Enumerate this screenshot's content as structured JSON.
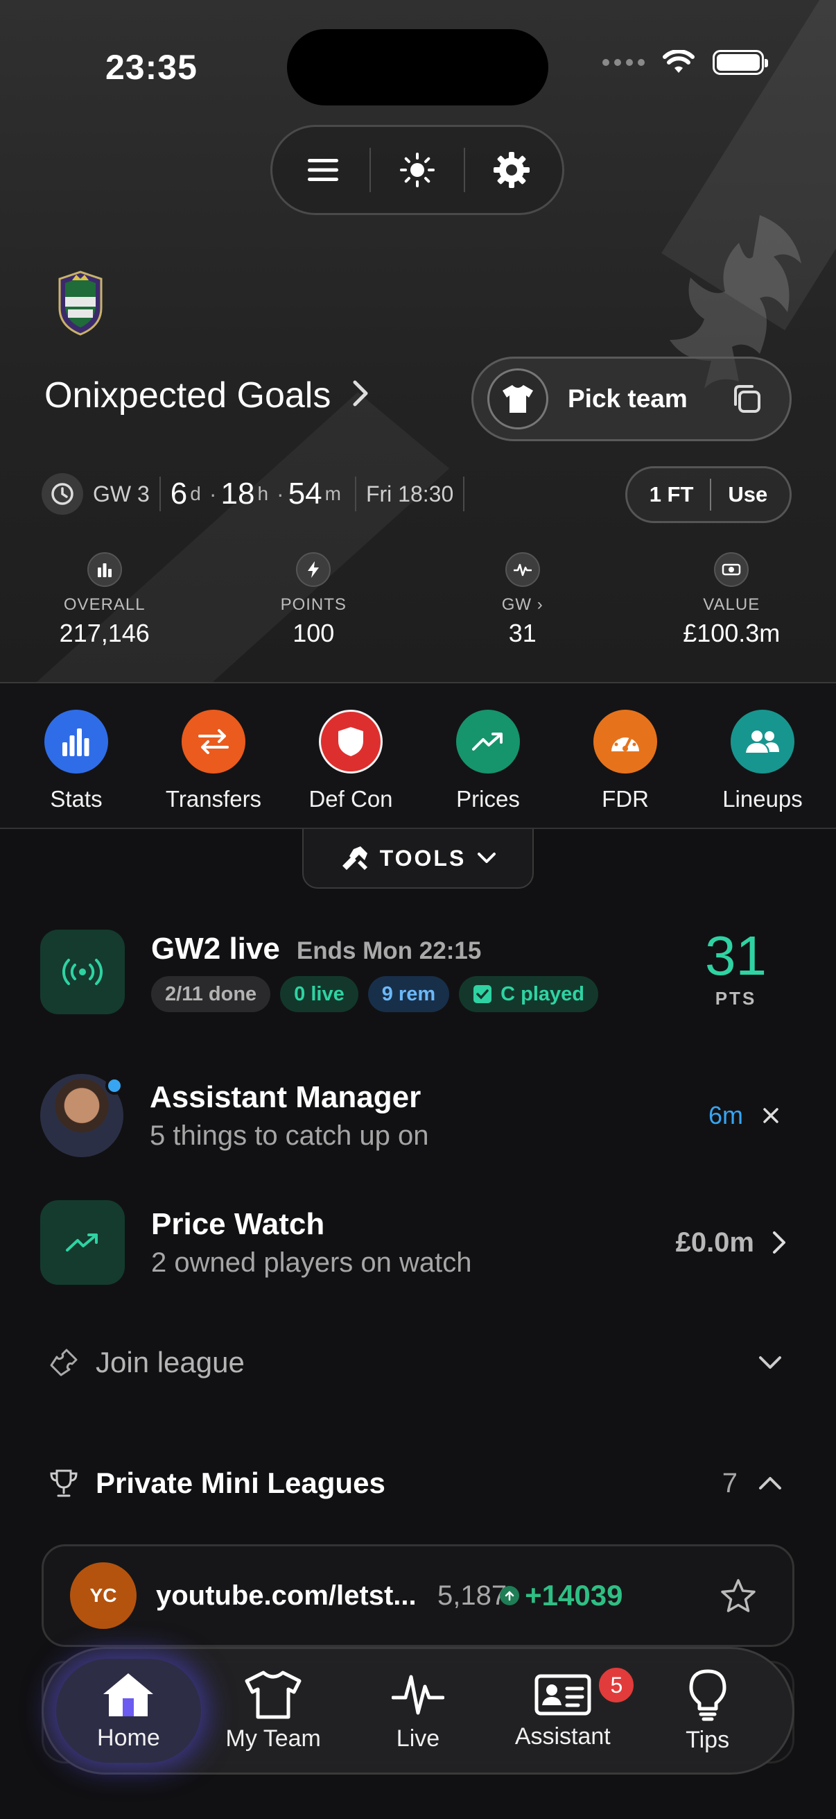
{
  "status_bar": {
    "time": "23:35"
  },
  "team": {
    "name": "Onixpected Goals",
    "pick_team_label": "Pick team"
  },
  "deadline": {
    "gw": "GW 3",
    "days": "6",
    "days_unit": "d",
    "hours": "18",
    "hours_unit": "h",
    "minutes": "54",
    "minutes_unit": "m",
    "date": "Fri 18:30",
    "ft": "1 FT",
    "use": "Use"
  },
  "stats": [
    {
      "label": "OVERALL",
      "value": "217,146",
      "icon": "bar-chart-icon"
    },
    {
      "label": "POINTS",
      "value": "100",
      "icon": "bolt-icon"
    },
    {
      "label": "GW ›",
      "value": "31",
      "icon": "pulse-icon"
    },
    {
      "label": "VALUE",
      "value": "£100.3m",
      "icon": "money-icon"
    }
  ],
  "quick_actions": [
    {
      "label": "Stats",
      "color": "#2f6de8",
      "icon": "bar-chart-icon"
    },
    {
      "label": "Transfers",
      "color": "#ea5b1d",
      "icon": "swap-icon"
    },
    {
      "label": "Def Con",
      "color": "#de2f2f",
      "icon": "shield-icon"
    },
    {
      "label": "Prices",
      "color": "#16946c",
      "icon": "trend-up-icon"
    },
    {
      "label": "FDR",
      "color": "#e6731c",
      "icon": "gauge-icon"
    },
    {
      "label": "Lineups",
      "color": "#17968f",
      "icon": "users-icon"
    }
  ],
  "tools": {
    "label": "TOOLS"
  },
  "gw_live": {
    "title": "GW2 live",
    "ends": "Ends Mon 22:15",
    "chips": [
      "2/11 done",
      "0 live",
      "9 rem",
      "C played"
    ],
    "points": "31",
    "points_unit": "PTS"
  },
  "assistant_manager": {
    "title": "Assistant Manager",
    "subtitle": "5 things to catch up on",
    "time": "6m"
  },
  "price_watch": {
    "title": "Price Watch",
    "subtitle": "2 owned players on watch",
    "value": "£0.0m"
  },
  "join_league": {
    "label": "Join league"
  },
  "mini_leagues": {
    "title": "Private Mini Leagues",
    "count": "7",
    "items": [
      {
        "initials": "YC",
        "name": "youtube.com/letst...",
        "rank": "5,187",
        "change": "+14039"
      }
    ]
  },
  "bottom_nav": [
    {
      "label": "Home"
    },
    {
      "label": "My Team"
    },
    {
      "label": "Live"
    },
    {
      "label": "Assistant",
      "badge": "5"
    },
    {
      "label": "Tips"
    }
  ],
  "colors": {
    "accent_green": "#2fd3a3",
    "accent_blue": "#37a5f2"
  }
}
